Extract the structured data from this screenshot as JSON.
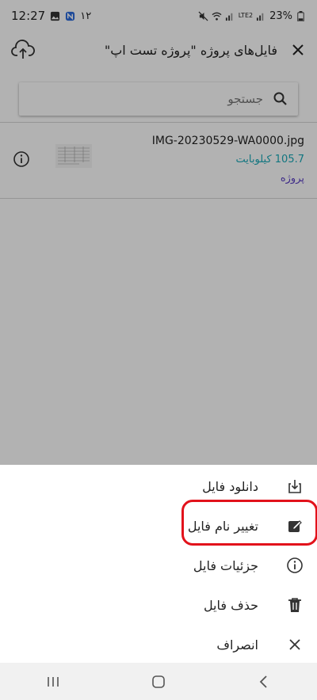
{
  "status_bar": {
    "time": "12:27",
    "notification_badge": "۱۲",
    "battery": "23%",
    "network": "LTE2"
  },
  "app_bar": {
    "title": "فایل‌های پروژه \"پروژه تست اپ\""
  },
  "search": {
    "placeholder": "جستجو"
  },
  "files": [
    {
      "name": "IMG-20230529-WA0000.jpg",
      "size": "105.7 کیلوبایت",
      "project": "پروژه"
    }
  ],
  "bottom_sheet": {
    "items": [
      {
        "label": "دانلود فایل",
        "icon": "download-icon"
      },
      {
        "label": "تغییر نام فایل",
        "icon": "edit-icon"
      },
      {
        "label": "جزئیات فایل",
        "icon": "info-icon"
      },
      {
        "label": "حذف فایل",
        "icon": "trash-icon"
      },
      {
        "label": "انصراف",
        "icon": "close-icon"
      }
    ],
    "highlighted_index": 1,
    "highlight_color": "#e2121b"
  },
  "colors": {
    "size_text": "#1aa9b8",
    "project_text": "#5b3fc4"
  }
}
